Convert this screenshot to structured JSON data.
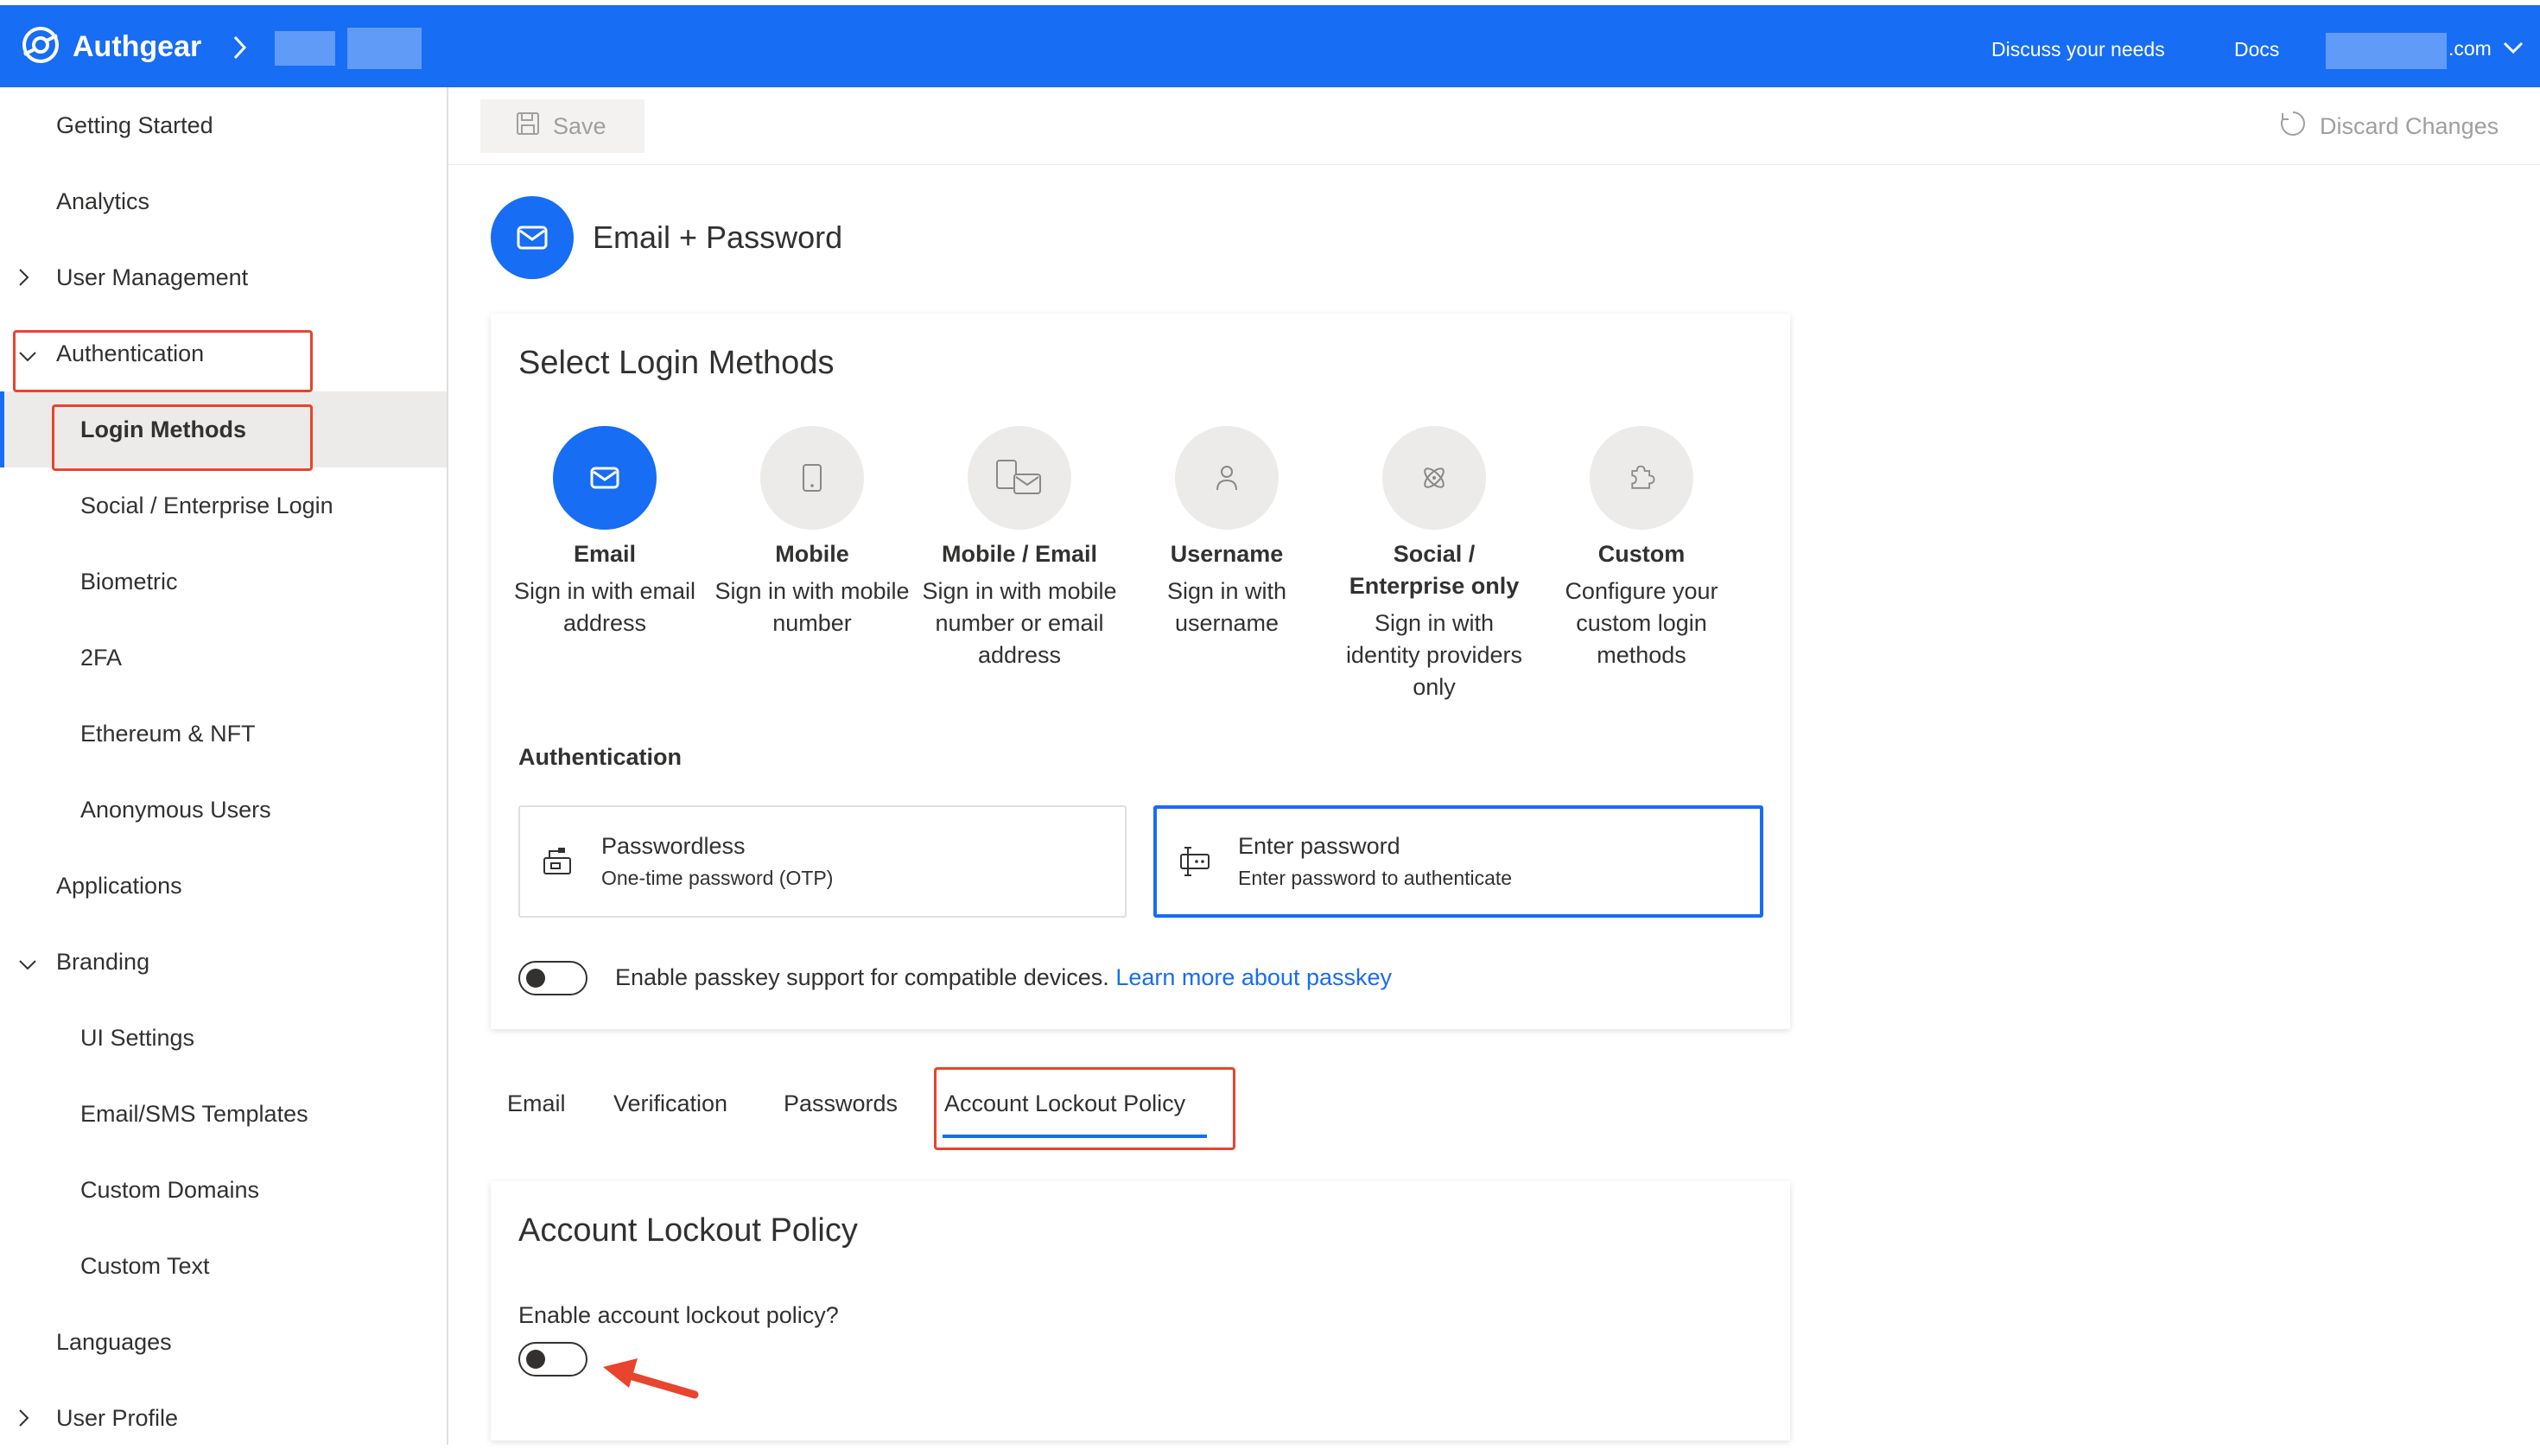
{
  "topbar": {
    "brand": "Authgear",
    "links": [
      "Discuss your needs",
      "Docs"
    ],
    "account_suffix": ".com"
  },
  "commandbar": {
    "save_label": "Save",
    "discard_label": "Discard Changes"
  },
  "sidebar": {
    "items": [
      {
        "label": "Getting Started"
      },
      {
        "label": "Analytics"
      },
      {
        "label": "User Management"
      },
      {
        "label": "Authentication"
      },
      {
        "label": "Login Methods"
      },
      {
        "label": "Social / Enterprise Login"
      },
      {
        "label": "Biometric"
      },
      {
        "label": "2FA"
      },
      {
        "label": "Ethereum & NFT"
      },
      {
        "label": "Anonymous Users"
      },
      {
        "label": "Applications"
      },
      {
        "label": "Branding"
      },
      {
        "label": "UI Settings"
      },
      {
        "label": "Email/SMS Templates"
      },
      {
        "label": "Custom Domains"
      },
      {
        "label": "Custom Text"
      },
      {
        "label": "Languages"
      },
      {
        "label": "User Profile"
      }
    ]
  },
  "page": {
    "title": "Email + Password"
  },
  "login_methods": {
    "title": "Select Login Methods",
    "methods": [
      {
        "name": "Email",
        "desc": "Sign in with email address",
        "icon": "envelope-icon"
      },
      {
        "name": "Mobile",
        "desc": "Sign in with mobile number",
        "icon": "phone-icon"
      },
      {
        "name": "Mobile / Email",
        "desc": "Sign in with mobile number or email address",
        "icon": "phone-envelope-icon"
      },
      {
        "name": "Username",
        "desc": "Sign in with username",
        "icon": "person-icon"
      },
      {
        "name": "Social / Enterprise only",
        "desc": "Sign in with identity providers only",
        "icon": "atom-icon"
      },
      {
        "name": "Custom",
        "desc": "Configure your custom login methods",
        "icon": "puzzle-icon"
      }
    ],
    "selected": "Email",
    "authentication_label": "Authentication",
    "auth_options": [
      {
        "title": "Passwordless",
        "sub": "One-time password (OTP)",
        "icon": "mailbox-icon"
      },
      {
        "title": "Enter password",
        "sub": "Enter password to authenticate",
        "icon": "password-field-icon"
      }
    ],
    "selected_auth": "Enter password",
    "passkey": {
      "label": "Enable passkey support for compatible devices.",
      "link": "Learn more about passkey",
      "enabled": false
    }
  },
  "tabs": {
    "items": [
      "Email",
      "Verification",
      "Passwords",
      "Account Lockout Policy"
    ],
    "active": "Account Lockout Policy"
  },
  "lockout": {
    "title": "Account Lockout Policy",
    "toggle_label": "Enable account lockout policy?",
    "enabled": false
  },
  "colors": {
    "accent": "#176df3",
    "highlight": "#e8442e"
  }
}
